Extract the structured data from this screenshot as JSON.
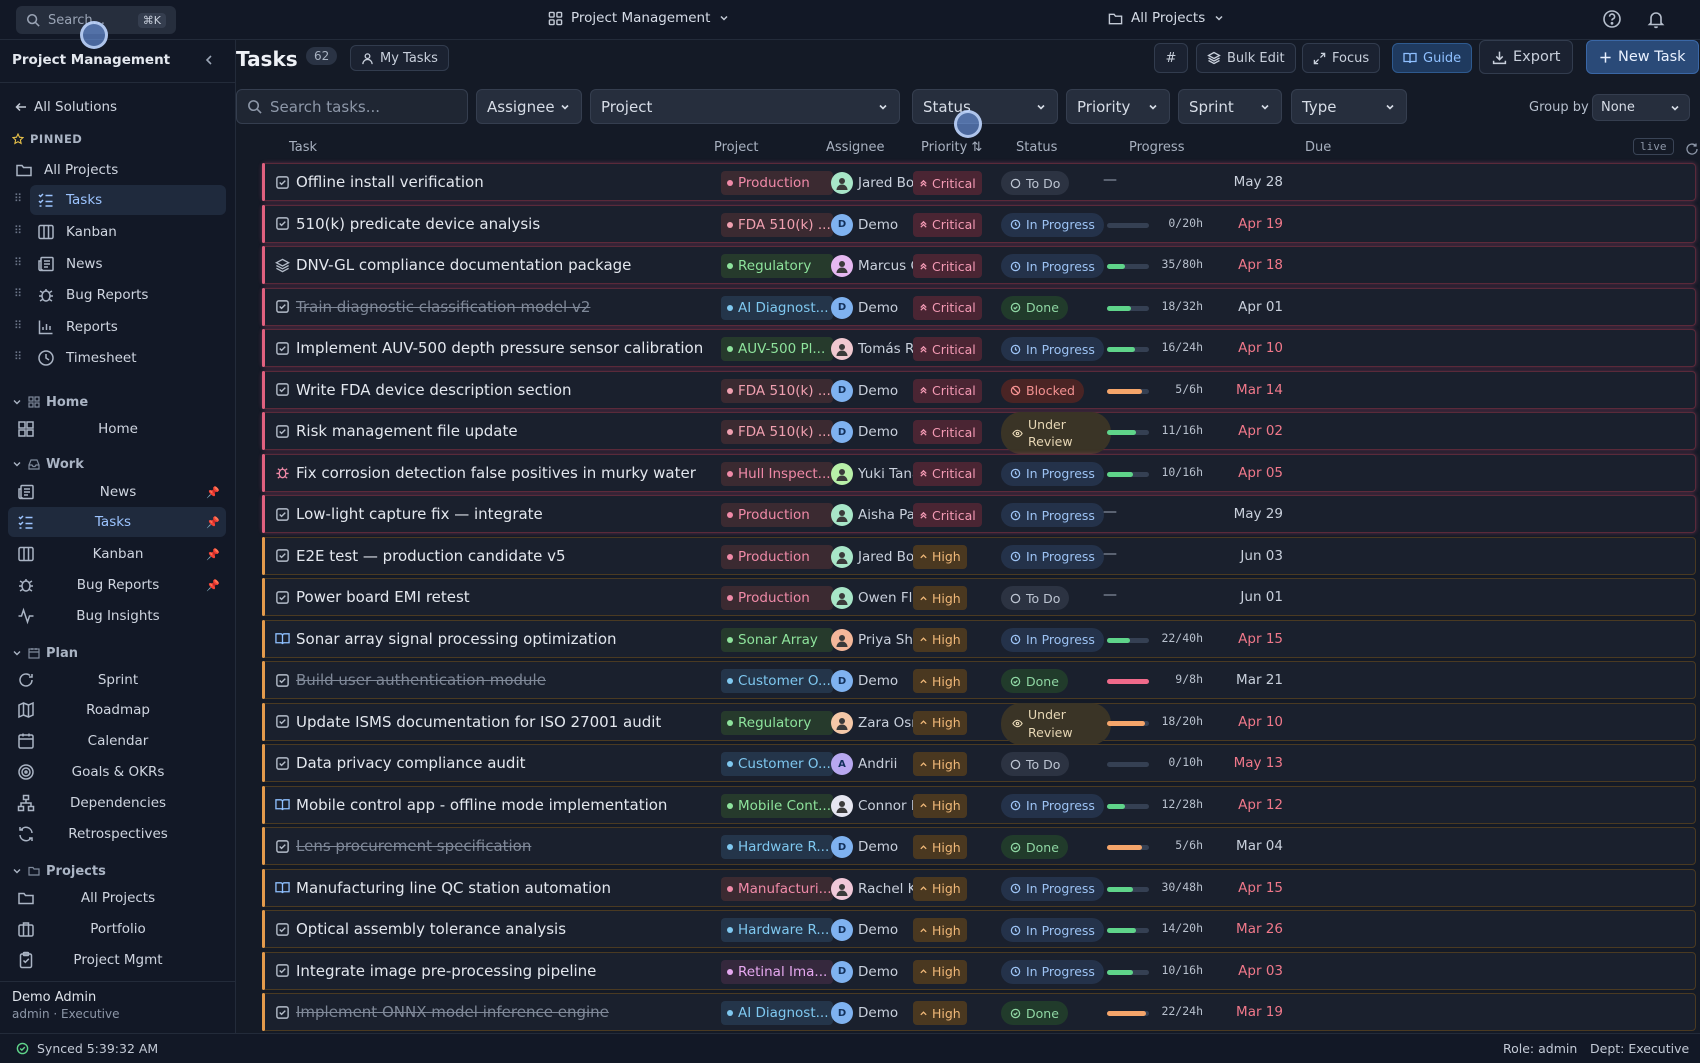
{
  "topbar": {
    "search_placeholder": "Search...",
    "search_shortcut": "⌘K",
    "workspace": "Project Management",
    "project_scope": "All Projects"
  },
  "sidebar": {
    "title": "Project Management",
    "back": "All Solutions",
    "pinned_header": "PINNED",
    "pinned": [
      "All Projects",
      "Tasks",
      "Kanban",
      "News",
      "Bug Reports",
      "Reports",
      "Timesheet"
    ],
    "sections": [
      {
        "name": "Home",
        "items": [
          "Home"
        ]
      },
      {
        "name": "Work",
        "items": [
          "News",
          "Tasks",
          "Kanban",
          "Bug Reports",
          "Bug Insights"
        ]
      },
      {
        "name": "Plan",
        "items": [
          "Sprint",
          "Roadmap",
          "Calendar",
          "Goals & OKRs",
          "Dependencies",
          "Retrospectives"
        ]
      },
      {
        "name": "Projects",
        "items": [
          "All Projects",
          "Portfolio",
          "Project Mgmt"
        ]
      }
    ],
    "user": {
      "name": "Demo Admin",
      "role": "admin · Executive"
    }
  },
  "main": {
    "title": "Tasks",
    "count": "62",
    "my_tasks": "My Tasks",
    "toolbar": {
      "hash": "#",
      "bulk_edit": "Bulk Edit",
      "focus": "Focus",
      "guide": "Guide",
      "export": "Export",
      "new_task": "New Task"
    },
    "filters": {
      "search_placeholder": "Search tasks...",
      "assignee": "Assignee",
      "project": "Project",
      "status": "Status",
      "priority": "Priority",
      "sprint": "Sprint",
      "type": "Type",
      "group_by_label": "Group by",
      "group_by_value": "None"
    },
    "columns": [
      "Task",
      "Project",
      "Assignee",
      "Priority ⇅",
      "Status",
      "Progress",
      "Due"
    ],
    "live": "live",
    "rows": [
      {
        "task": "Offline install verification",
        "type": "task",
        "done": false,
        "project": "Production",
        "pcolor": "#f08aa8",
        "pbg": "#3b2a31",
        "assignee": "Jared Booth",
        "av": "img",
        "avbg": "#a8e6c8",
        "priority": "Critical",
        "status": "To Do",
        "progress": null,
        "hours": "",
        "due": "May 28",
        "overdue": false
      },
      {
        "task": "510(k) predicate device analysis",
        "type": "task",
        "done": false,
        "project": "FDA 510(k) ...",
        "pcolor": "#f0a0b0",
        "pbg": "#3b2a31",
        "assignee": "Demo",
        "av": "D",
        "avbg": "#7fb2f0",
        "priority": "Critical",
        "status": "In Progress",
        "progress": 0,
        "pfill": "#5fd48a",
        "hours": "0/20h",
        "due": "Apr 19",
        "overdue": true
      },
      {
        "task": "DNV-GL compliance documentation package",
        "type": "epic",
        "done": false,
        "project": "Regulatory",
        "pcolor": "#8ee39c",
        "pbg": "#263a2c",
        "assignee": "Marcus Chen",
        "av": "img",
        "avbg": "#e6b8f0",
        "priority": "Critical",
        "status": "In Progress",
        "progress": 44,
        "pfill": "#5fd48a",
        "hours": "35/80h",
        "due": "Apr 18",
        "overdue": true
      },
      {
        "task": "Train diagnostic classification model v2",
        "type": "task",
        "done": true,
        "project": "AI Diagnost...",
        "pcolor": "#7fc8f0",
        "pbg": "#24354a",
        "assignee": "Demo",
        "av": "D",
        "avbg": "#7fb2f0",
        "priority": "Critical",
        "status": "Done",
        "progress": 56,
        "pfill": "#5fd48a",
        "hours": "18/32h",
        "due": "Apr 01",
        "overdue": false
      },
      {
        "task": "Implement AUV-500 depth pressure sensor calibration",
        "type": "task",
        "done": false,
        "project": "AUV-500 Pl...",
        "pcolor": "#8ee39c",
        "pbg": "#263a2c",
        "assignee": "Tomás Reyes",
        "av": "img",
        "avbg": "#f0c8d0",
        "priority": "Critical",
        "status": "In Progress",
        "progress": 67,
        "pfill": "#5fd48a",
        "hours": "16/24h",
        "due": "Apr 10",
        "overdue": true
      },
      {
        "task": "Write FDA device description section",
        "type": "task",
        "done": false,
        "project": "FDA 510(k) ...",
        "pcolor": "#f0a0b0",
        "pbg": "#3b2a31",
        "assignee": "Demo",
        "av": "D",
        "avbg": "#7fb2f0",
        "priority": "Critical",
        "status": "Blocked",
        "progress": 83,
        "pfill": "#f5a56a",
        "hours": "5/6h",
        "due": "Mar 14",
        "overdue": true
      },
      {
        "task": "Risk management file update",
        "type": "task",
        "done": false,
        "project": "FDA 510(k) ...",
        "pcolor": "#f0a0b0",
        "pbg": "#3b2a31",
        "assignee": "Demo",
        "av": "D",
        "avbg": "#7fb2f0",
        "priority": "Critical",
        "status": "Under Review",
        "progress": 69,
        "pfill": "#5fd48a",
        "hours": "11/16h",
        "due": "Apr 02",
        "overdue": true
      },
      {
        "task": "Fix corrosion detection false positives in murky water",
        "type": "bug",
        "done": false,
        "project": "Hull Inspect...",
        "pcolor": "#f08aa8",
        "pbg": "#3b2a31",
        "assignee": "Yuki Tanaka",
        "av": "img",
        "avbg": "#b8f0a8",
        "priority": "Critical",
        "status": "In Progress",
        "progress": 63,
        "pfill": "#5fd48a",
        "hours": "10/16h",
        "due": "Apr 05",
        "overdue": true
      },
      {
        "task": "Low-light capture fix — integrate",
        "type": "task",
        "done": false,
        "project": "Production",
        "pcolor": "#f08aa8",
        "pbg": "#3b2a31",
        "assignee": "Aisha Patel",
        "av": "img",
        "avbg": "#a8e6c8",
        "priority": "Critical",
        "status": "In Progress",
        "progress": null,
        "hours": "",
        "due": "May 29",
        "overdue": false
      },
      {
        "task": "E2E test — production candidate v5",
        "type": "task",
        "done": false,
        "project": "Production",
        "pcolor": "#f08aa8",
        "pbg": "#3b2a31",
        "assignee": "Jared Booth",
        "av": "img",
        "avbg": "#a8e6c8",
        "priority": "High",
        "status": "In Progress",
        "progress": null,
        "hours": "",
        "due": "Jun 03",
        "overdue": false
      },
      {
        "task": "Power board EMI retest",
        "type": "task",
        "done": false,
        "project": "Production",
        "pcolor": "#f08aa8",
        "pbg": "#3b2a31",
        "assignee": "Owen Fletcher",
        "av": "img",
        "avbg": "#a8e6c8",
        "priority": "High",
        "status": "To Do",
        "progress": null,
        "hours": "",
        "due": "Jun 01",
        "overdue": false
      },
      {
        "task": "Sonar array signal processing optimization",
        "type": "story",
        "done": false,
        "project": "Sonar Array",
        "pcolor": "#8ee39c",
        "pbg": "#263a2c",
        "assignee": "Priya Sharma",
        "av": "img",
        "avbg": "#f5b89a",
        "priority": "High",
        "status": "In Progress",
        "progress": 55,
        "pfill": "#5fd48a",
        "hours": "22/40h",
        "due": "Apr 15",
        "overdue": true
      },
      {
        "task": "Build user authentication module",
        "type": "task",
        "done": true,
        "project": "Customer O...",
        "pcolor": "#7fc8f0",
        "pbg": "#24354a",
        "assignee": "Demo",
        "av": "D",
        "avbg": "#7fb2f0",
        "priority": "High",
        "status": "Done",
        "progress": 100,
        "pfill": "#f06a8a",
        "hours": "9/8h",
        "due": "Mar 21",
        "overdue": false
      },
      {
        "task": "Update ISMS documentation for ISO 27001 audit",
        "type": "task",
        "done": false,
        "project": "Regulatory",
        "pcolor": "#8ee39c",
        "pbg": "#263a2c",
        "assignee": "Zara Osman",
        "av": "img",
        "avbg": "#f5c8a8",
        "priority": "High",
        "status": "Under Review",
        "progress": 90,
        "pfill": "#f5a56a",
        "hours": "18/20h",
        "due": "Apr 10",
        "overdue": true
      },
      {
        "task": "Data privacy compliance audit",
        "type": "task",
        "done": false,
        "project": "Customer O...",
        "pcolor": "#7fc8f0",
        "pbg": "#24354a",
        "assignee": "Andrii",
        "av": "A",
        "avbg": "#b8a8f0",
        "priority": "High",
        "status": "To Do",
        "progress": 0,
        "pfill": "#5fd48a",
        "hours": "0/10h",
        "due": "May 13",
        "overdue": true
      },
      {
        "task": "Mobile control app - offline mode implementation",
        "type": "story",
        "done": false,
        "project": "Mobile Cont...",
        "pcolor": "#8ee39c",
        "pbg": "#263a2c",
        "assignee": "Connor Mc",
        "av": "img",
        "avbg": "#e6e6f0",
        "priority": "High",
        "status": "In Progress",
        "progress": 43,
        "pfill": "#5fd48a",
        "hours": "12/28h",
        "due": "Apr 12",
        "overdue": true
      },
      {
        "task": "Lens procurement specification",
        "type": "task",
        "done": true,
        "project": "Hardware R...",
        "pcolor": "#7fc8f0",
        "pbg": "#24354a",
        "assignee": "Demo",
        "av": "D",
        "avbg": "#7fb2f0",
        "priority": "High",
        "status": "Done",
        "progress": 83,
        "pfill": "#f5a56a",
        "hours": "5/6h",
        "due": "Mar 04",
        "overdue": false
      },
      {
        "task": "Manufacturing line QC station automation",
        "type": "story",
        "done": false,
        "project": "Manufacturi...",
        "pcolor": "#f08aa8",
        "pbg": "#3b2a31",
        "assignee": "Rachel Kim",
        "av": "img",
        "avbg": "#f0c8d8",
        "priority": "High",
        "status": "In Progress",
        "progress": 63,
        "pfill": "#5fd48a",
        "hours": "30/48h",
        "due": "Apr 15",
        "overdue": true
      },
      {
        "task": "Optical assembly tolerance analysis",
        "type": "task",
        "done": false,
        "project": "Hardware R...",
        "pcolor": "#7fc8f0",
        "pbg": "#24354a",
        "assignee": "Demo",
        "av": "D",
        "avbg": "#7fb2f0",
        "priority": "High",
        "status": "In Progress",
        "progress": 70,
        "pfill": "#5fd48a",
        "hours": "14/20h",
        "due": "Mar 26",
        "overdue": true
      },
      {
        "task": "Integrate image pre-processing pipeline",
        "type": "task",
        "done": false,
        "project": "Retinal Ima...",
        "pcolor": "#e6a8f0",
        "pbg": "#35283d",
        "assignee": "Demo",
        "av": "D",
        "avbg": "#7fb2f0",
        "priority": "High",
        "status": "In Progress",
        "progress": 63,
        "pfill": "#5fd48a",
        "hours": "10/16h",
        "due": "Apr 03",
        "overdue": true
      },
      {
        "task": "Implement ONNX model inference engine",
        "type": "task",
        "done": true,
        "project": "AI Diagnost...",
        "pcolor": "#7fc8f0",
        "pbg": "#24354a",
        "assignee": "Demo",
        "av": "D",
        "avbg": "#7fb2f0",
        "priority": "High",
        "status": "Done",
        "progress": 92,
        "pfill": "#f5a56a",
        "hours": "22/24h",
        "due": "Mar 19",
        "overdue": true
      }
    ]
  },
  "statusbar": {
    "synced": "Synced 5:39:32 AM",
    "role": "Role: admin",
    "dept": "Dept: Executive"
  }
}
